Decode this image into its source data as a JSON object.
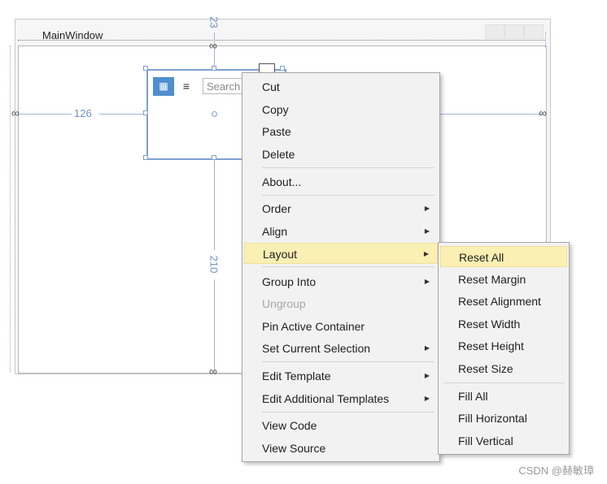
{
  "window": {
    "title": "MainWindow"
  },
  "control": {
    "search_placeholder": "Search",
    "list_icon": "list-view-icon",
    "list_icon2": "lines-icon"
  },
  "measurements": {
    "top": "23",
    "left": "126",
    "bottom": "210"
  },
  "context_menu": {
    "items": [
      {
        "label": "Cut"
      },
      {
        "label": "Copy"
      },
      {
        "label": "Paste"
      },
      {
        "label": "Delete"
      },
      {
        "label": "About..."
      },
      {
        "label": "Order",
        "arrow": "▶"
      },
      {
        "label": "Align",
        "arrow": "▶"
      },
      {
        "label": "Layout",
        "arrow": "▶"
      },
      {
        "label": "Group Into",
        "arrow": "▶"
      },
      {
        "label": "Ungroup"
      },
      {
        "label": "Pin Active Container"
      },
      {
        "label": "Set Current Selection",
        "arrow": "▶"
      },
      {
        "label": "Edit Template",
        "arrow": "▶"
      },
      {
        "label": "Edit Additional Templates",
        "arrow": "▶"
      },
      {
        "label": "View Code"
      },
      {
        "label": "View Source"
      }
    ]
  },
  "layout_submenu": {
    "items": [
      {
        "label": "Reset All"
      },
      {
        "label": "Reset Margin"
      },
      {
        "label": "Reset Alignment"
      },
      {
        "label": "Reset Width"
      },
      {
        "label": "Reset Height"
      },
      {
        "label": "Reset Size"
      },
      {
        "label": "Fill All"
      },
      {
        "label": "Fill Horizontal"
      },
      {
        "label": "Fill Vertical"
      }
    ]
  },
  "watermark": "CSDN @赫敏璋"
}
